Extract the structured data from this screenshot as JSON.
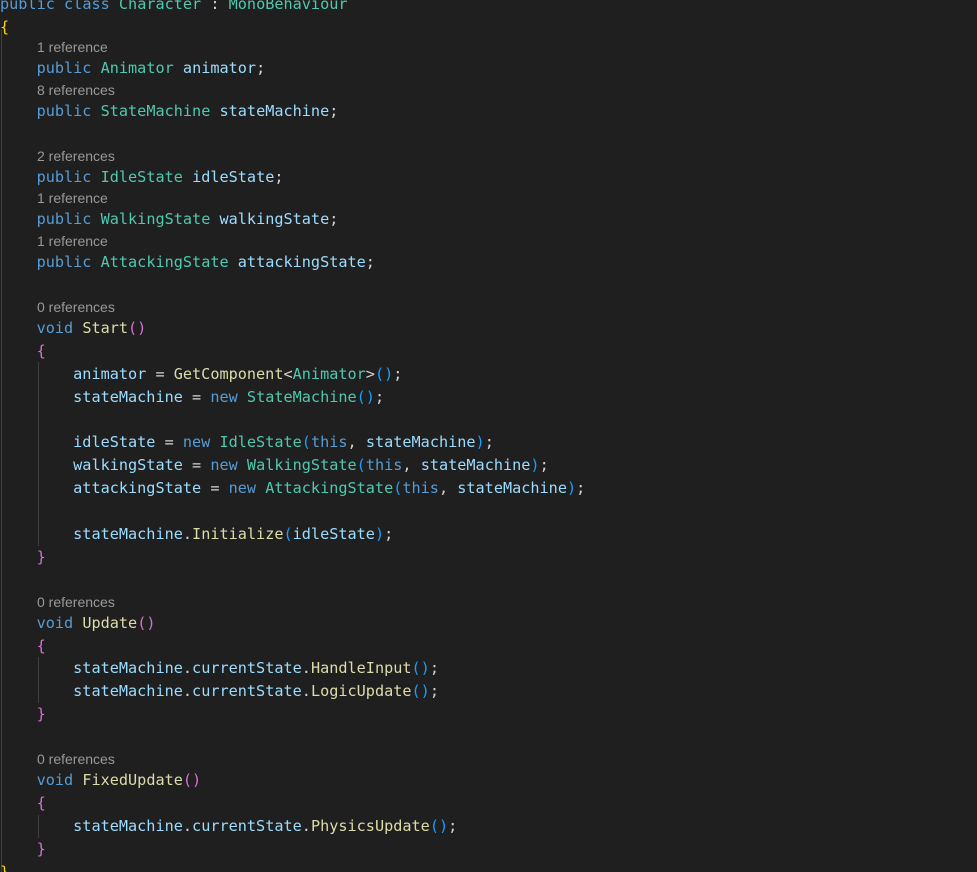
{
  "colors": {
    "background": "#1f1f1f",
    "default": "#d4d4d4",
    "keyword": "#569cd6",
    "type": "#4ec9b0",
    "variable": "#9cdcfe",
    "method": "#dcdcaa",
    "codelens": "#999999",
    "bracket_gold": "#ffd700",
    "bracket_pink": "#da70d6",
    "bracket_blue": "#179fff",
    "indent_guide": "#404040"
  },
  "codelens": [
    "1 reference",
    "8 references",
    "2 references",
    "1 reference",
    "1 reference",
    "0 references",
    "0 references",
    "0 references"
  ],
  "code": [
    [
      [
        "public",
        "keyword"
      ],
      [
        " ",
        "default"
      ],
      [
        "class",
        "keyword"
      ],
      [
        " ",
        "default"
      ],
      [
        "Character",
        "type"
      ],
      [
        " : ",
        "default"
      ],
      [
        "MonoBehaviour",
        "type"
      ]
    ],
    [
      [
        "{",
        "bracket_gold"
      ]
    ],
    [
      [
        "    ",
        "default"
      ],
      [
        "public",
        "keyword"
      ],
      [
        " ",
        "default"
      ],
      [
        "Animator",
        "type"
      ],
      [
        " ",
        "default"
      ],
      [
        "animator",
        "variable"
      ],
      [
        ";",
        "default"
      ]
    ],
    [
      [
        "    ",
        "default"
      ],
      [
        "public",
        "keyword"
      ],
      [
        " ",
        "default"
      ],
      [
        "StateMachine",
        "type"
      ],
      [
        " ",
        "default"
      ],
      [
        "stateMachine",
        "variable"
      ],
      [
        ";",
        "default"
      ]
    ],
    [
      [
        "    ",
        "default"
      ],
      [
        "public",
        "keyword"
      ],
      [
        " ",
        "default"
      ],
      [
        "IdleState",
        "type"
      ],
      [
        " ",
        "default"
      ],
      [
        "idleState",
        "variable"
      ],
      [
        ";",
        "default"
      ]
    ],
    [
      [
        "    ",
        "default"
      ],
      [
        "public",
        "keyword"
      ],
      [
        " ",
        "default"
      ],
      [
        "WalkingState",
        "type"
      ],
      [
        " ",
        "default"
      ],
      [
        "walkingState",
        "variable"
      ],
      [
        ";",
        "default"
      ]
    ],
    [
      [
        "    ",
        "default"
      ],
      [
        "public",
        "keyword"
      ],
      [
        " ",
        "default"
      ],
      [
        "AttackingState",
        "type"
      ],
      [
        " ",
        "default"
      ],
      [
        "attackingState",
        "variable"
      ],
      [
        ";",
        "default"
      ]
    ],
    [
      [
        "    ",
        "default"
      ],
      [
        "void",
        "keyword"
      ],
      [
        " ",
        "default"
      ],
      [
        "Start",
        "method"
      ],
      [
        "()",
        "bracket_pink"
      ]
    ],
    [
      [
        "    ",
        "default"
      ],
      [
        "{",
        "bracket_pink"
      ]
    ],
    [
      [
        "        ",
        "default"
      ],
      [
        "animator",
        "variable"
      ],
      [
        " = ",
        "default"
      ],
      [
        "GetComponent",
        "method"
      ],
      [
        "<",
        "default"
      ],
      [
        "Animator",
        "type"
      ],
      [
        ">",
        "default"
      ],
      [
        "()",
        "bracket_blue"
      ],
      [
        ";",
        "default"
      ]
    ],
    [
      [
        "        ",
        "default"
      ],
      [
        "stateMachine",
        "variable"
      ],
      [
        " = ",
        "default"
      ],
      [
        "new",
        "keyword"
      ],
      [
        " ",
        "default"
      ],
      [
        "StateMachine",
        "type"
      ],
      [
        "()",
        "bracket_blue"
      ],
      [
        ";",
        "default"
      ]
    ],
    [
      [
        "        ",
        "default"
      ],
      [
        "idleState",
        "variable"
      ],
      [
        " = ",
        "default"
      ],
      [
        "new",
        "keyword"
      ],
      [
        " ",
        "default"
      ],
      [
        "IdleState",
        "type"
      ],
      [
        "(",
        "bracket_blue"
      ],
      [
        "this",
        "keyword"
      ],
      [
        ", ",
        "default"
      ],
      [
        "stateMachine",
        "variable"
      ],
      [
        ")",
        "bracket_blue"
      ],
      [
        ";",
        "default"
      ]
    ],
    [
      [
        "        ",
        "default"
      ],
      [
        "walkingState",
        "variable"
      ],
      [
        " = ",
        "default"
      ],
      [
        "new",
        "keyword"
      ],
      [
        " ",
        "default"
      ],
      [
        "WalkingState",
        "type"
      ],
      [
        "(",
        "bracket_blue"
      ],
      [
        "this",
        "keyword"
      ],
      [
        ", ",
        "default"
      ],
      [
        "stateMachine",
        "variable"
      ],
      [
        ")",
        "bracket_blue"
      ],
      [
        ";",
        "default"
      ]
    ],
    [
      [
        "        ",
        "default"
      ],
      [
        "attackingState",
        "variable"
      ],
      [
        " = ",
        "default"
      ],
      [
        "new",
        "keyword"
      ],
      [
        " ",
        "default"
      ],
      [
        "AttackingState",
        "type"
      ],
      [
        "(",
        "bracket_blue"
      ],
      [
        "this",
        "keyword"
      ],
      [
        ", ",
        "default"
      ],
      [
        "stateMachine",
        "variable"
      ],
      [
        ")",
        "bracket_blue"
      ],
      [
        ";",
        "default"
      ]
    ],
    [
      [
        "        ",
        "default"
      ],
      [
        "stateMachine",
        "variable"
      ],
      [
        ".",
        "default"
      ],
      [
        "Initialize",
        "method"
      ],
      [
        "(",
        "bracket_blue"
      ],
      [
        "idleState",
        "variable"
      ],
      [
        ")",
        "bracket_blue"
      ],
      [
        ";",
        "default"
      ]
    ],
    [
      [
        "    ",
        "default"
      ],
      [
        "}",
        "bracket_pink"
      ]
    ],
    [
      [
        "    ",
        "default"
      ],
      [
        "void",
        "keyword"
      ],
      [
        " ",
        "default"
      ],
      [
        "Update",
        "method"
      ],
      [
        "()",
        "bracket_pink"
      ]
    ],
    [
      [
        "    ",
        "default"
      ],
      [
        "{",
        "bracket_pink"
      ]
    ],
    [
      [
        "        ",
        "default"
      ],
      [
        "stateMachine",
        "variable"
      ],
      [
        ".",
        "default"
      ],
      [
        "currentState",
        "variable"
      ],
      [
        ".",
        "default"
      ],
      [
        "HandleInput",
        "method"
      ],
      [
        "()",
        "bracket_blue"
      ],
      [
        ";",
        "default"
      ]
    ],
    [
      [
        "        ",
        "default"
      ],
      [
        "stateMachine",
        "variable"
      ],
      [
        ".",
        "default"
      ],
      [
        "currentState",
        "variable"
      ],
      [
        ".",
        "default"
      ],
      [
        "LogicUpdate",
        "method"
      ],
      [
        "()",
        "bracket_blue"
      ],
      [
        ";",
        "default"
      ]
    ],
    [
      [
        "    ",
        "default"
      ],
      [
        "}",
        "bracket_pink"
      ]
    ],
    [
      [
        "    ",
        "default"
      ],
      [
        "void",
        "keyword"
      ],
      [
        " ",
        "default"
      ],
      [
        "FixedUpdate",
        "method"
      ],
      [
        "()",
        "bracket_pink"
      ]
    ],
    [
      [
        "    ",
        "default"
      ],
      [
        "{",
        "bracket_pink"
      ]
    ],
    [
      [
        "        ",
        "default"
      ],
      [
        "stateMachine",
        "variable"
      ],
      [
        ".",
        "default"
      ],
      [
        "currentState",
        "variable"
      ],
      [
        ".",
        "default"
      ],
      [
        "PhysicsUpdate",
        "method"
      ],
      [
        "()",
        "bracket_blue"
      ],
      [
        ";",
        "default"
      ]
    ],
    [
      [
        "    ",
        "default"
      ],
      [
        "}",
        "bracket_pink"
      ]
    ],
    [
      [
        "}",
        "bracket_gold"
      ]
    ]
  ]
}
